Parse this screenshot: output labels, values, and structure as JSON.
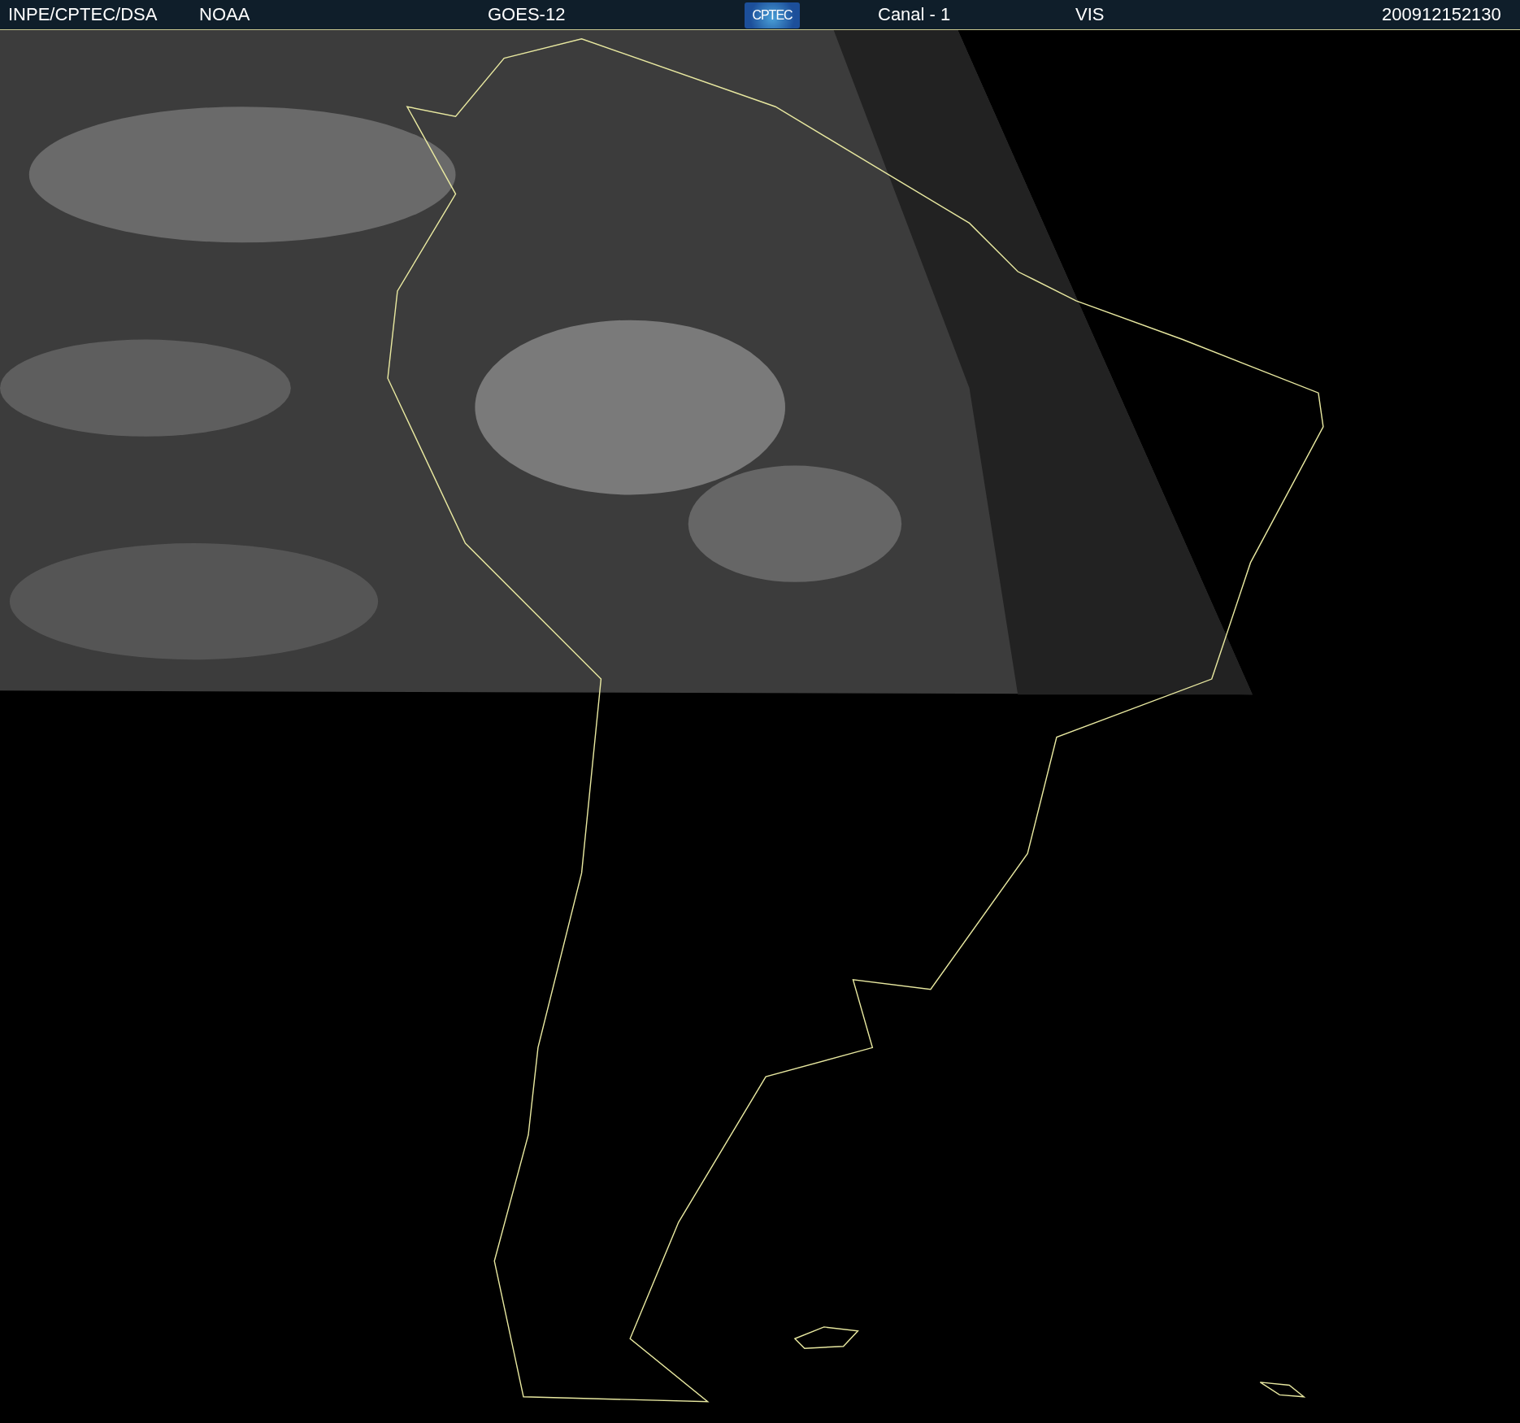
{
  "header": {
    "source": "INPE/CPTEC/DSA",
    "agency": "NOAA",
    "satellite": "GOES-12",
    "logo": "CPTEC",
    "channel": "Canal - 1",
    "band": "VIS",
    "timestamp": "200912152130"
  }
}
